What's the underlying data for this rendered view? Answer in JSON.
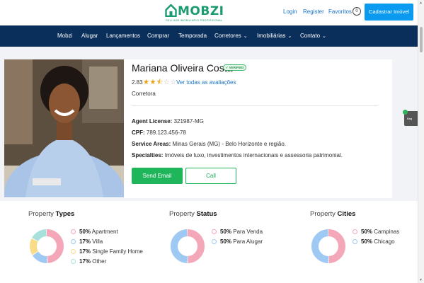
{
  "header": {
    "logo_text": "MOBZI",
    "logo_tagline": "SEU HUB IMOBILIÁRIO PROFISSIONAL",
    "login": "Login",
    "register": "Register",
    "favorites": "Favoritos",
    "favorites_count": "0",
    "cta": "Cadastrar Imóvel"
  },
  "nav": {
    "items": [
      "Mobzi",
      "Alugar",
      "Lançamentos",
      "Comprar",
      "Temporada",
      "Corretores",
      "Imobiliárias",
      "Contato"
    ]
  },
  "agent": {
    "name": "Mariana Oliveira Costa",
    "verified": "VERIFIED",
    "rating": "2.83",
    "stars_value": 2.5,
    "reviews_link": "Ver todas as avaliações",
    "role": "Corretora",
    "license_label": "Agent License:",
    "license_value": "321987-MG",
    "cpf_label": "CPF:",
    "cpf_value": "789.123.456-78",
    "areas_label": "Service Areas:",
    "areas_value": "Minas Gerais (MG) - Belo Horizonte e região.",
    "specialties_label": "Specialties:",
    "specialties_value": "Imóveis de luxo, investimentos internacionais e assessoria patrimonial.",
    "send_email": "Send Email",
    "call": "Call"
  },
  "side_tab": {
    "label": "Bag",
    "badge": "1"
  },
  "stats": {
    "types": {
      "title_prefix": "Property",
      "title_bold": "Types",
      "items": [
        {
          "pct": "50%",
          "label": "Apartment",
          "value": 50,
          "color": "#f4a7b9"
        },
        {
          "pct": "17%",
          "label": "Villa",
          "value": 17,
          "color": "#9ec9f3"
        },
        {
          "pct": "17%",
          "label": "Single Family Home",
          "value": 17,
          "color": "#f9dc8a"
        },
        {
          "pct": "17%",
          "label": "Other",
          "value": 17,
          "color": "#a8e0dc"
        }
      ]
    },
    "status": {
      "title_prefix": "Property",
      "title_bold": "Status",
      "items": [
        {
          "pct": "50%",
          "label": "Para Venda",
          "value": 50,
          "color": "#f4a7b9"
        },
        {
          "pct": "50%",
          "label": "Para Alugar",
          "value": 50,
          "color": "#9ec9f3"
        }
      ]
    },
    "cities": {
      "title_prefix": "Property",
      "title_bold": "Cities",
      "items": [
        {
          "pct": "50%",
          "label": "Campinas",
          "value": 50,
          "color": "#f4a7b9"
        },
        {
          "pct": "50%",
          "label": "Chicago",
          "value": 50,
          "color": "#9ec9f3"
        }
      ]
    }
  }
}
